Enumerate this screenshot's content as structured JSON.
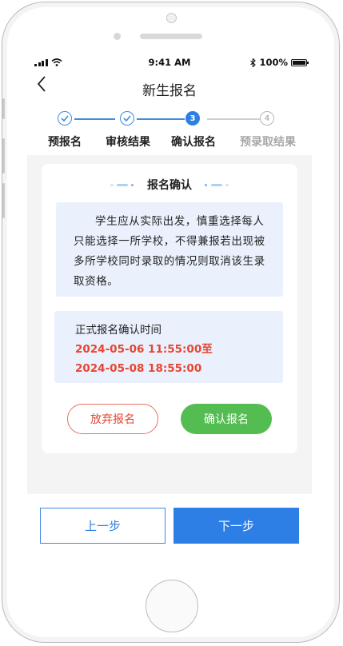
{
  "statusbar": {
    "time": "9:41 AM",
    "battery": "100%"
  },
  "navbar": {
    "back_icon": "chevron-left-icon",
    "title": "新生报名"
  },
  "steps": {
    "items": [
      {
        "label": "预报名",
        "state": "done",
        "marker": "✓"
      },
      {
        "label": "审核结果",
        "state": "done",
        "marker": "✓"
      },
      {
        "label": "确认报名",
        "state": "current",
        "marker": "3"
      },
      {
        "label": "预录取结果",
        "state": "todo",
        "marker": "4"
      }
    ]
  },
  "card": {
    "title": "报名确认",
    "notice": "学生应从实际出发，慎重选择每人只能选择一所学校，不得兼报若出现被多所学校同时录取的情况则取消该生录取资格。",
    "time_label": "正式报名确认时间",
    "time_start": "2024-05-06  11:55:00至",
    "time_end": "2024-05-08  18:55:00",
    "abandon_label": "放弃报名",
    "confirm_label": "确认报名"
  },
  "footer": {
    "prev_label": "上一步",
    "next_label": "下一步"
  },
  "colors": {
    "primary": "#2d7fe6",
    "danger": "#e8452f",
    "success": "#54bd52",
    "notice_bg": "#eaf1fd"
  }
}
